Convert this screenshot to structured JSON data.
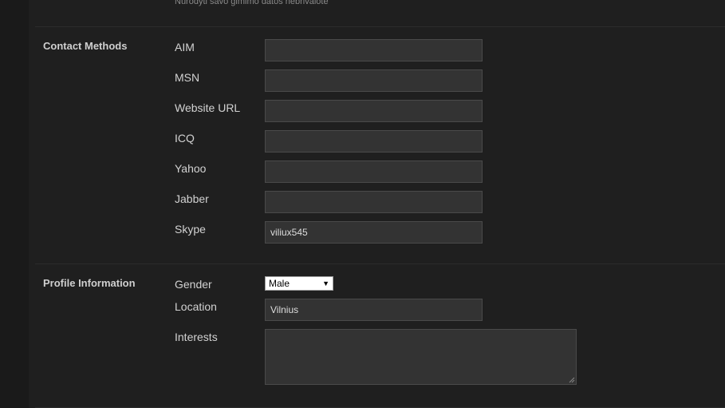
{
  "header": {
    "hint": "Nurodyti savo gimimo datos nebrivalote"
  },
  "contact_methods": {
    "title": "Contact Methods",
    "fields": [
      {
        "label": "AIM",
        "value": ""
      },
      {
        "label": "MSN",
        "value": ""
      },
      {
        "label": "Website URL",
        "value": ""
      },
      {
        "label": "ICQ",
        "value": ""
      },
      {
        "label": "Yahoo",
        "value": ""
      },
      {
        "label": "Jabber",
        "value": ""
      },
      {
        "label": "Skype",
        "value": "viliux545"
      }
    ]
  },
  "profile_information": {
    "title": "Profile Information",
    "gender": {
      "label": "Gender",
      "selected": "Male"
    },
    "location": {
      "label": "Location",
      "value": "Vilnius"
    },
    "interests": {
      "label": "Interests",
      "value": ""
    }
  },
  "icons": {
    "select_arrow": "chevron-down-icon",
    "resize": "resize-grip-icon"
  }
}
